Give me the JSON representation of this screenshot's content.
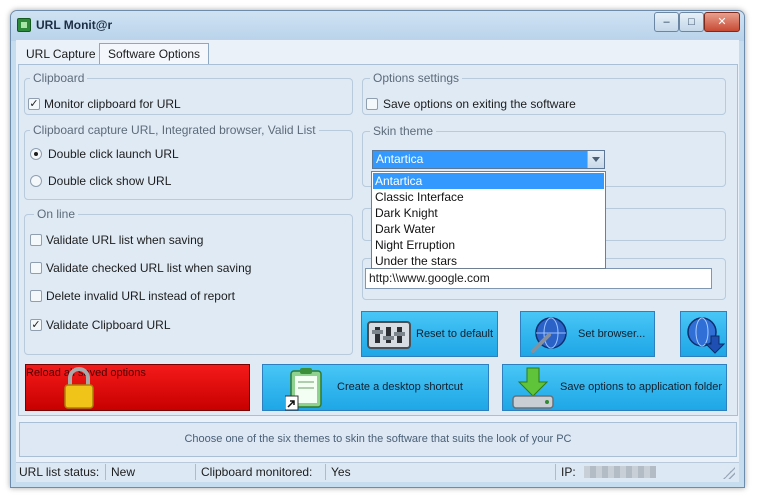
{
  "window": {
    "title": "URL Monit@r"
  },
  "tabs": [
    {
      "label": "URL Capture"
    },
    {
      "label": "Software Options"
    }
  ],
  "clipboard_group": {
    "title": "Clipboard",
    "monitor": {
      "label": "Monitor clipboard for URL",
      "checked": true
    }
  },
  "launch_group": {
    "title": "Clipboard capture URL, Integrated browser, Valid List",
    "options": [
      {
        "label": "Double click launch URL",
        "selected": true
      },
      {
        "label": "Double click show URL",
        "selected": false
      }
    ]
  },
  "online_group": {
    "title": "On line",
    "items": [
      {
        "label": "Validate URL list when saving",
        "checked": false
      },
      {
        "label": "Validate checked URL list when saving",
        "checked": false
      },
      {
        "label": "Delete invalid URL instead of report",
        "checked": false
      },
      {
        "label": "Validate Clipboard URL",
        "checked": true
      }
    ]
  },
  "options_group": {
    "title": "Options settings",
    "save_on_exit": {
      "label": "Save options on exiting the software",
      "checked": false
    }
  },
  "skin_group": {
    "title": "Skin theme",
    "selected": "Antartica",
    "options": [
      "Antartica",
      "Classic Interface",
      "Dark Knight",
      "Dark Water",
      "Night Erruption",
      "Under the stars"
    ]
  },
  "browser": {
    "url": "http:\\\\www.google.com"
  },
  "buttons": {
    "reset": "Reset to default",
    "set_browser": "Set browser...",
    "reload": "Reload all saved options",
    "shortcut": "Create a desktop shortcut",
    "save_app_folder": "Save options to application folder"
  },
  "status_message": "Choose one of the six themes to skin the software that suits the look of your PC",
  "statusbar": {
    "url_list_label": "URL list status:",
    "url_list_value": "New",
    "clipboard_label": "Clipboard monitored:",
    "clipboard_value": "Yes",
    "ip_label": "IP:"
  },
  "colors": {
    "accent_blue": "#3399ff",
    "button_cyan": "#2bb4f0",
    "button_red": "#e00000"
  }
}
